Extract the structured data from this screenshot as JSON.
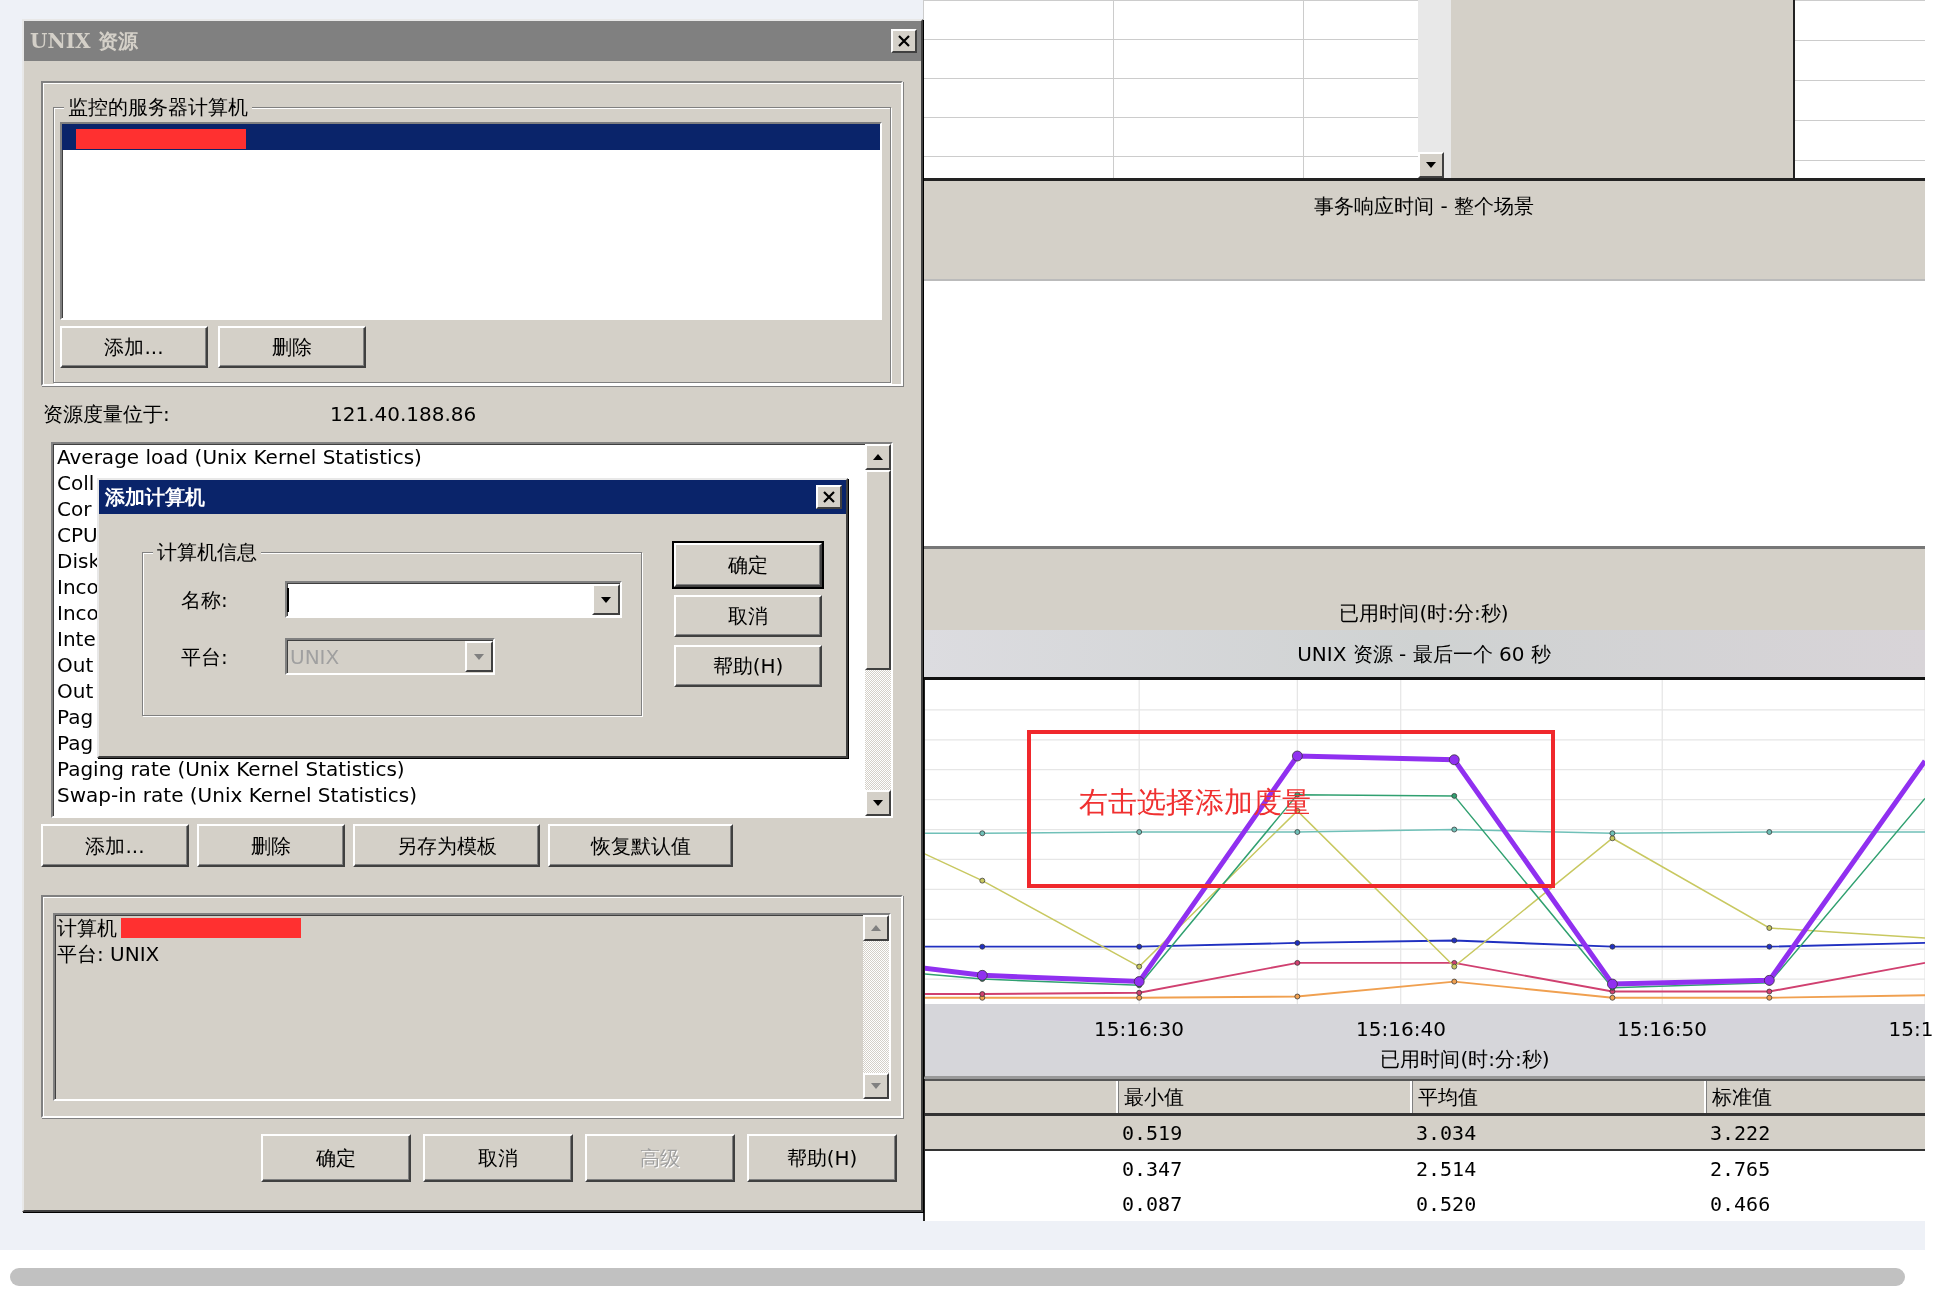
{
  "main_dialog": {
    "title": "UNIX 资源",
    "active": false
  },
  "servers_group": {
    "title": "监控的服务器计算机",
    "items": [
      {
        "selected": true,
        "redacted": true
      }
    ],
    "buttons": [
      {
        "label": "添加...",
        "disabled": false
      },
      {
        "label": "删除",
        "disabled": false
      }
    ]
  },
  "location": {
    "label": "资源度量位于:",
    "value": "121.40.188.86"
  },
  "measures": [
    {
      "label": "Average load (Unix Kernel Statistics)"
    },
    {
      "label": "Coll"
    },
    {
      "label": "Cor"
    },
    {
      "label": "CPU"
    },
    {
      "label": "Disk"
    },
    {
      "label": "Inco"
    },
    {
      "label": "Inco"
    },
    {
      "label": "Inte"
    },
    {
      "label": "Out"
    },
    {
      "label": "Out"
    },
    {
      "label": "Pag"
    },
    {
      "label": "Pag"
    },
    {
      "label": "Paging rate (Unix Kernel Statistics)"
    },
    {
      "label": "Swap-in rate (Unix Kernel Statistics)"
    }
  ],
  "measure_buttons": [
    {
      "label": "添加...",
      "disabled": false
    },
    {
      "label": "删除",
      "disabled": false
    },
    {
      "label": "另存为模板",
      "disabled": false
    },
    {
      "label": "恢复默认值",
      "disabled": false
    }
  ],
  "info": {
    "lines": [
      {
        "text": "计算机",
        "redacted": true
      },
      {
        "text": "平台: UNIX",
        "redacted": false
      }
    ]
  },
  "dialog_buttons": [
    {
      "label": "确定",
      "disabled": false
    },
    {
      "label": "取消",
      "disabled": false
    },
    {
      "label": "高级",
      "disabled": true
    },
    {
      "label": "帮助(H)",
      "disabled": false
    }
  ],
  "add_computer_dialog": {
    "title": "添加计算机",
    "active": true,
    "group_title": "计算机信息",
    "fields": [
      {
        "label": "名称:",
        "disabled": false,
        "focused": true
      },
      {
        "label": "平台:",
        "value": "UNIX",
        "disabled": true,
        "focused": false
      }
    ],
    "buttons": [
      {
        "label": "确定",
        "default": true
      },
      {
        "label": "取消",
        "default": false
      },
      {
        "label": "帮助(H)",
        "default": false
      }
    ]
  },
  "background": {
    "scenario_title": "事务响应时间 - 整个场景",
    "elapsed_label": "已用时间(时:分:秒)",
    "chart_title": "UNIX 资源 - 最后一个 60 秒",
    "x_ticks": [
      "15:16:30",
      "15:16:40",
      "15:16:50",
      "15:1"
    ],
    "x_axis_label": "已用时间(时:分:秒)",
    "annotation": "右击选择添加度量",
    "table": {
      "columns": [
        "最小值",
        "平均值",
        "标准值"
      ],
      "rows": [
        {
          "selected": true,
          "cells": [
            "0.519",
            "3.034",
            "3.222"
          ]
        },
        {
          "selected": false,
          "cells": [
            "0.347",
            "2.514",
            "2.765"
          ]
        },
        {
          "selected": false,
          "cells": [
            "0.087",
            "0.520",
            "0.466"
          ]
        }
      ]
    }
  }
}
